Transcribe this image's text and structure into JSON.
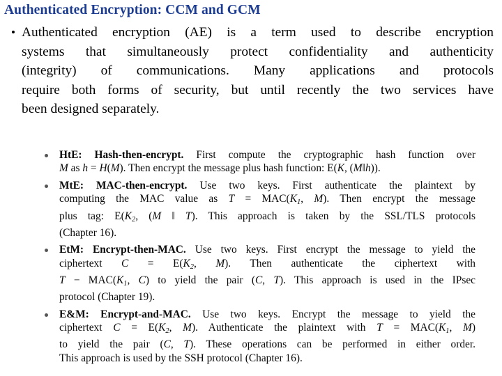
{
  "slide": {
    "title": "Authenticated Encryption: CCM and GCM",
    "title_color": "#1c3c91",
    "background_color": "#ffffff",
    "body_color": "#000000"
  },
  "intro_bullets": [
    {
      "marker": "round-bullet",
      "lines": [
        "Authenticated encryption (AE) is a term used to describe encryption",
        "systems that simultaneously protect confidentiality and authenticity",
        "(integrity) of communications. Many applications and protocols",
        "require both forms of security, but until recently the two services have",
        "been designed separately."
      ],
      "full_text": "Authenticated encryption (AE) is a term used to describe encryption systems that simultaneously protect confidentiality and authenticity (integrity) of communications. Many applications and protocols require both forms of security, but until recently the two services have been designed separately."
    }
  ],
  "figure": {
    "marker": "round-bullet",
    "marker_color": "#585858",
    "items": [
      {
        "id": "hte",
        "term": "HtE: Hash-then-encrypt.",
        "lines": [
          "HtE: Hash-then-encrypt. First compute the cryptographic hash function over",
          "M as h = H(M). Then encrypt the message plus hash function: E(K, (M‖h))."
        ],
        "full_text": "HtE: Hash-then-encrypt. First compute the cryptographic hash function over M as h = H(M). Then encrypt the message plus hash function: E(K, (M‖h))."
      },
      {
        "id": "mte",
        "term": "MtE: MAC-then-encrypt.",
        "lines": [
          "MtE: MAC-then-encrypt. Use two keys. First authenticate the plaintext by",
          "computing the MAC value as T = MAC(K1, M). Then encrypt the message",
          "plus tag: E(K2, (M ‖ T). This approach is taken by the SSL/TLS protocols",
          "(Chapter 16)."
        ],
        "full_text": "MtE: MAC-then-encrypt. Use two keys. First authenticate the plaintext by computing the MAC value as T = MAC(K1, M). Then encrypt the message plus tag: E(K2, (M ‖ T). This approach is taken by the SSL/TLS protocols (Chapter 16)."
      },
      {
        "id": "etm",
        "term": "EtM: Encrypt-then-MAC.",
        "lines": [
          "EtM: Encrypt-then-MAC. Use two keys. First encrypt the message to yield the",
          "ciphertext C = E(K2, M). Then authenticate the ciphertext with",
          "T − MAC(K1, C) to yield the pair (C, T). This approach is used in the IPsec",
          "protocol (Chapter 19)."
        ],
        "full_text": "EtM: Encrypt-then-MAC. Use two keys. First encrypt the message to yield the ciphertext C = E(K2, M). Then authenticate the ciphertext with T − MAC(K1, C) to yield the pair (C, T). This approach is used in the IPsec protocol (Chapter 19)."
      },
      {
        "id": "eam",
        "term": "E&M: Encrypt-and-MAC.",
        "lines": [
          "E&M: Encrypt-and-MAC. Use two keys. Encrypt the message to yield the",
          "ciphertext C = E(K2, M). Authenticate the plaintext with T = MAC(K1, M)",
          "to yield the pair (C, T). These operations can be performed in either order.",
          "This approach is used by the SSH protocol (Chapter 16)."
        ],
        "full_text": "E&M: Encrypt-and-MAC. Use two keys. Encrypt the message to yield the ciphertext C = E(K2, M). Authenticate the plaintext with T = MAC(K1, M) to yield the pair (C, T). These operations can be performed in either order. This approach is used by the SSH protocol (Chapter 16)."
      }
    ]
  }
}
